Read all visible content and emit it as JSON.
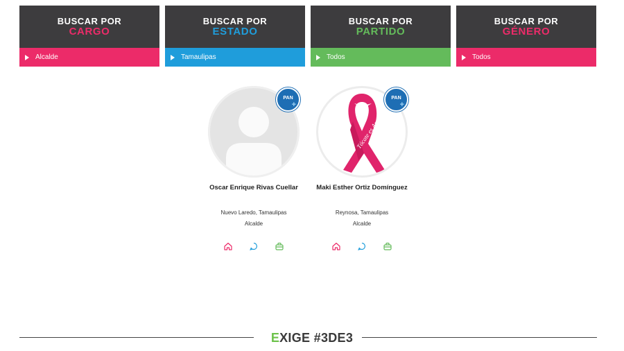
{
  "filters": [
    {
      "line1": "BUSCAR POR",
      "line2": "CARGO",
      "accent": "#ec2b69",
      "value": "Alcalde"
    },
    {
      "line1": "BUSCAR POR",
      "line2": "ESTADO",
      "accent": "#1f9ddb",
      "value": "Tamaulipas"
    },
    {
      "line1": "BUSCAR POR",
      "line2": "PARTIDO",
      "accent": "#64bb5b",
      "value": "Todos"
    },
    {
      "line1": "BUSCAR POR",
      "line2": "GÉNERO",
      "accent": "#ec2b69",
      "value": "Todos"
    }
  ],
  "candidates": [
    {
      "name": "Oscar Enrique Rivas Cuellar",
      "place": "Nuevo Laredo, Tamaulipas",
      "role": "Alcalde",
      "avatar": "placeholder-avatar",
      "badge": "PAN"
    },
    {
      "name": "Maki Esther Ortiz Domínguez",
      "place": "Reynosa, Tamaulipas",
      "role": "Alcalde",
      "avatar": "pink-ribbon-image",
      "badge": "PAN",
      "ribbon_text": "Tócate es Amarte"
    }
  ],
  "icons": [
    "home-icon",
    "chat-icon",
    "briefcase-icon"
  ],
  "icon_colors": [
    "#ec2b69",
    "#1f9ddb",
    "#64bb5b"
  ],
  "footer": {
    "first_letter": "E",
    "rest": "XIGE #3DE3"
  }
}
